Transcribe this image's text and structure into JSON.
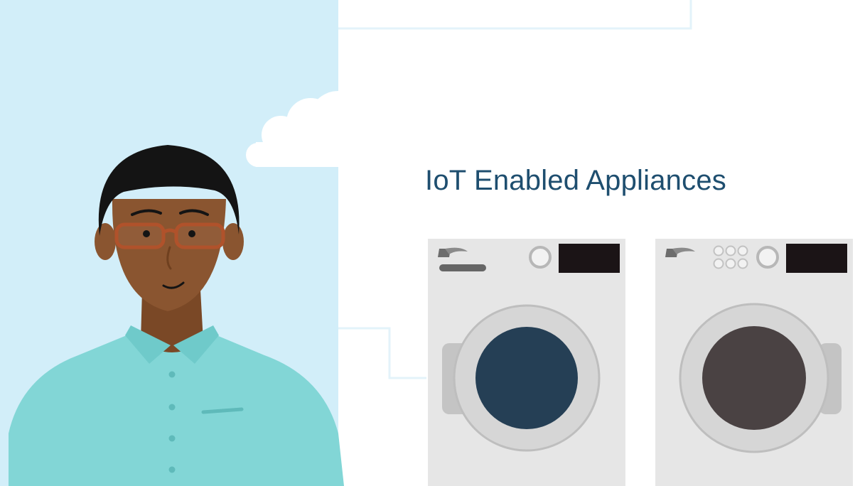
{
  "title": "IoT Enabled Appliances",
  "colors": {
    "sky": "#d2eef9",
    "title_text": "#1e4e6f",
    "shirt": "#82d6d6",
    "skin": "#8a5530",
    "hair": "#141414",
    "glasses": "#b0522b",
    "appliance_body": "#e6e6e6",
    "washer_door": "#253f55",
    "dryer_door": "#4a4243",
    "display_panel": "#1b1416"
  },
  "icons": {
    "brand_logo": "brand-logo-icon",
    "dial": "dial-icon",
    "button_grid": "button-grid-icon"
  }
}
